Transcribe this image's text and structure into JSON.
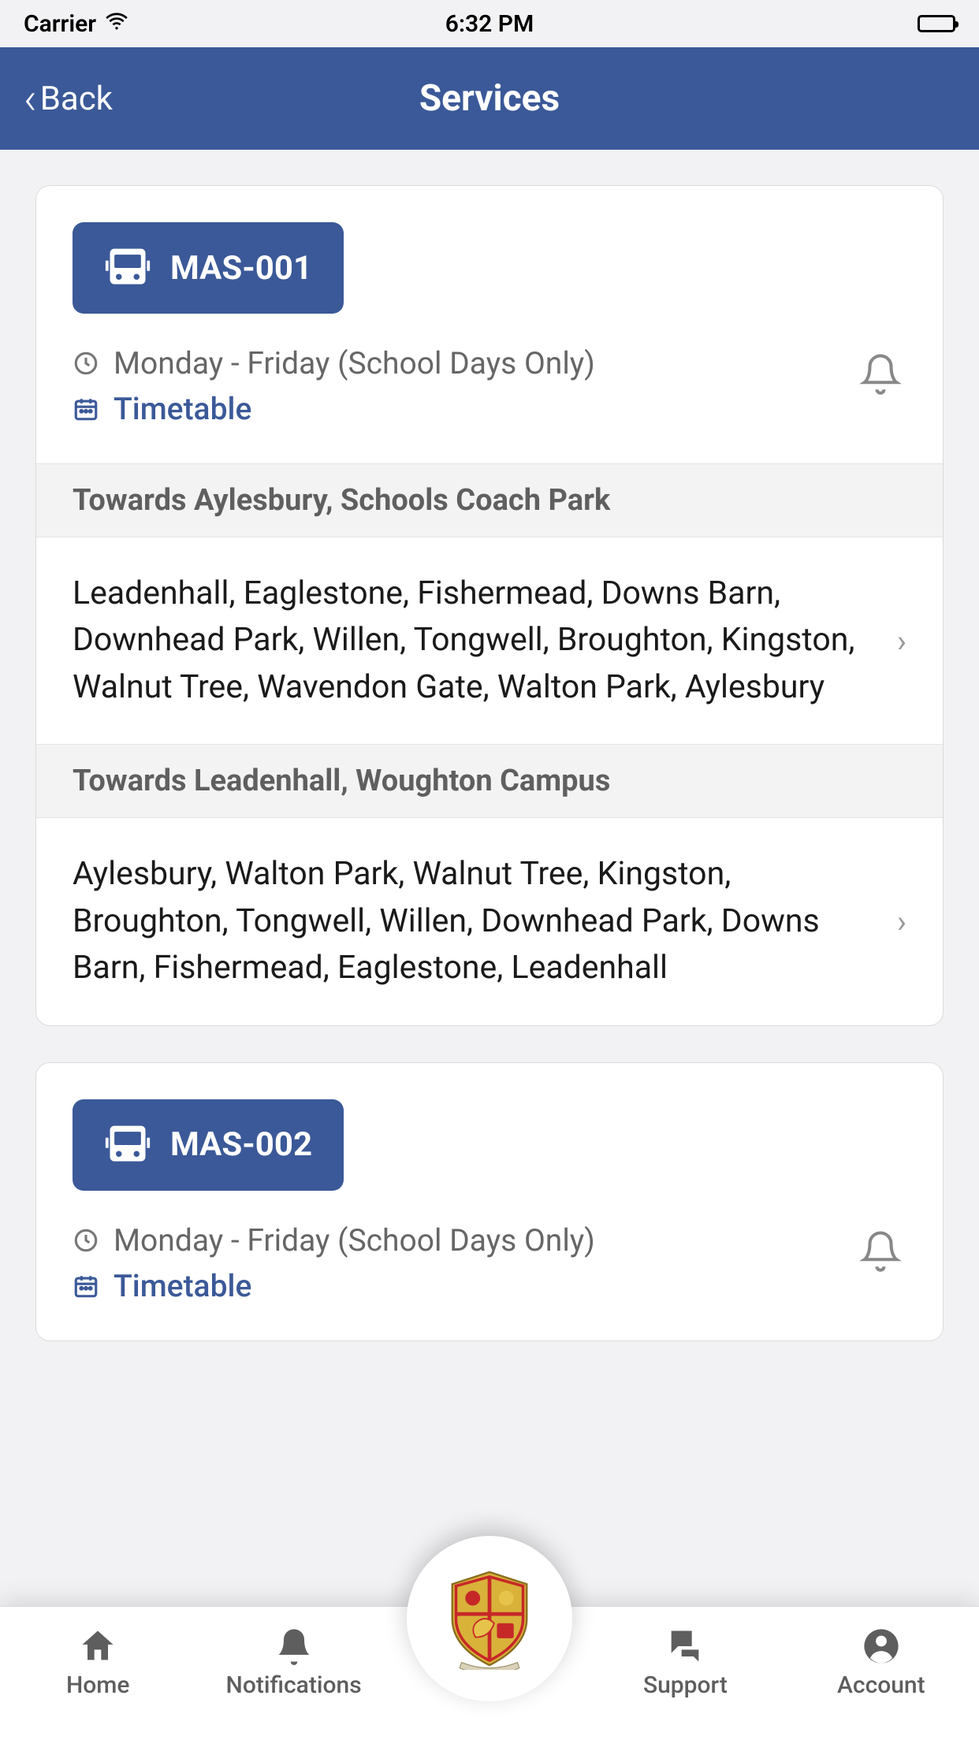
{
  "status": {
    "carrier": "Carrier",
    "time": "6:32 PM"
  },
  "nav": {
    "back": "Back",
    "title": "Services"
  },
  "services": [
    {
      "name": "MAS-001",
      "schedule": "Monday - Friday (School Days Only)",
      "timetable_label": "Timetable",
      "routes": [
        {
          "direction": "Towards Aylesbury, Schools Coach Park",
          "stops": "Leadenhall, Eaglestone, Fishermead, Downs Barn, Downhead Park, Willen, Tongwell, Broughton, Kingston, Walnut Tree, Wavendon Gate, Walton Park, Aylesbury"
        },
        {
          "direction": "Towards Leadenhall, Woughton Campus",
          "stops": "Aylesbury, Walton Park, Walnut Tree, Kingston, Broughton, Tongwell, Willen, Downhead Park, Downs Barn, Fishermead, Eaglestone, Leadenhall"
        }
      ]
    },
    {
      "name": "MAS-002",
      "schedule": "Monday - Friday (School Days Only)",
      "timetable_label": "Timetable",
      "routes": []
    }
  ],
  "tabs": {
    "home": "Home",
    "notifications": "Notifications",
    "support": "Support",
    "account": "Account"
  }
}
